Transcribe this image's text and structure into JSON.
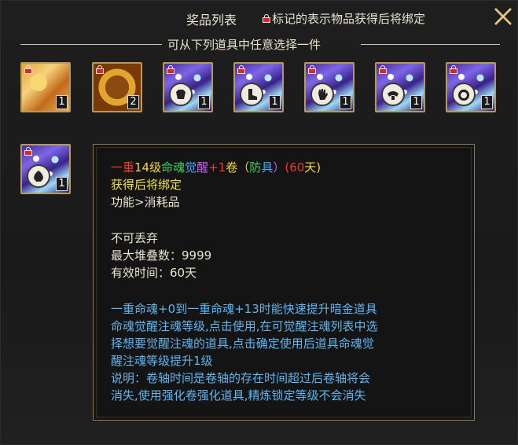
{
  "header": {
    "title": "奖品列表",
    "bind_notice": "标记的表示物品获得后将绑定",
    "subtitle": "可从下列道具中任意选择一件"
  },
  "items": [
    {
      "name": "scroll",
      "count": "1",
      "locked": true
    },
    {
      "name": "golden-orb",
      "count": "2",
      "locked": true
    },
    {
      "name": "soul-scroll-armor-1",
      "count": "1",
      "locked": true
    },
    {
      "name": "soul-scroll-armor-2",
      "count": "1",
      "locked": true
    },
    {
      "name": "soul-scroll-armor-3",
      "count": "1",
      "locked": true
    },
    {
      "name": "soul-scroll-armor-4",
      "count": "1",
      "locked": true
    },
    {
      "name": "soul-scroll-armor-5",
      "count": "1",
      "locked": true
    }
  ],
  "selected_item": {
    "count": "1",
    "locked": true
  },
  "tooltip": {
    "name_parts": [
      {
        "text": "一重",
        "color": "#f23a2a"
      },
      {
        "text": "14级",
        "color": "#f3d53b"
      },
      {
        "text": "命魂",
        "color": "#38d85a"
      },
      {
        "text": "觉",
        "color": "#4aa8f5"
      },
      {
        "text": "醒",
        "color": "#c35ef0"
      },
      {
        "text": "+1",
        "color": "#f23a2a"
      },
      {
        "text": "卷（",
        "color": "#f3d53b"
      },
      {
        "text": "防",
        "color": "#38d85a"
      },
      {
        "text": "具",
        "color": "#4aa8f5"
      },
      {
        "text": "）",
        "color": "#c35ef0"
      },
      {
        "text": "(60",
        "color": "#f23a2a"
      },
      {
        "text": "天)",
        "color": "#f3d53b"
      }
    ],
    "bind_text": "获得后将绑定",
    "category": "功能>消耗品",
    "undroppable": "不可丢弃",
    "max_stack": "最大堆叠数：9999",
    "duration": "有效时间：60天",
    "desc_lines": [
      "一重命魂+0到一重命魂+13时能快速提升暗金道具",
      "命魂觉醒注魂等级,点击使用,在可觉醒注魂列表中选",
      "择想要觉醒注魂的道具,点击确定使用后道具命魂觉",
      "醒注魂等级提升1级",
      "说明：卷轴时间是卷轴的存在时间超过后卷轴将会",
      "消失,使用强化卷强化道具,精炼锁定等级不会消失"
    ]
  },
  "colors": {
    "frame_gold": "#b79a5a",
    "desc_blue": "#5fb6f0",
    "bind_yellow": "#f3e33b",
    "text_light": "#e8e2d0"
  }
}
